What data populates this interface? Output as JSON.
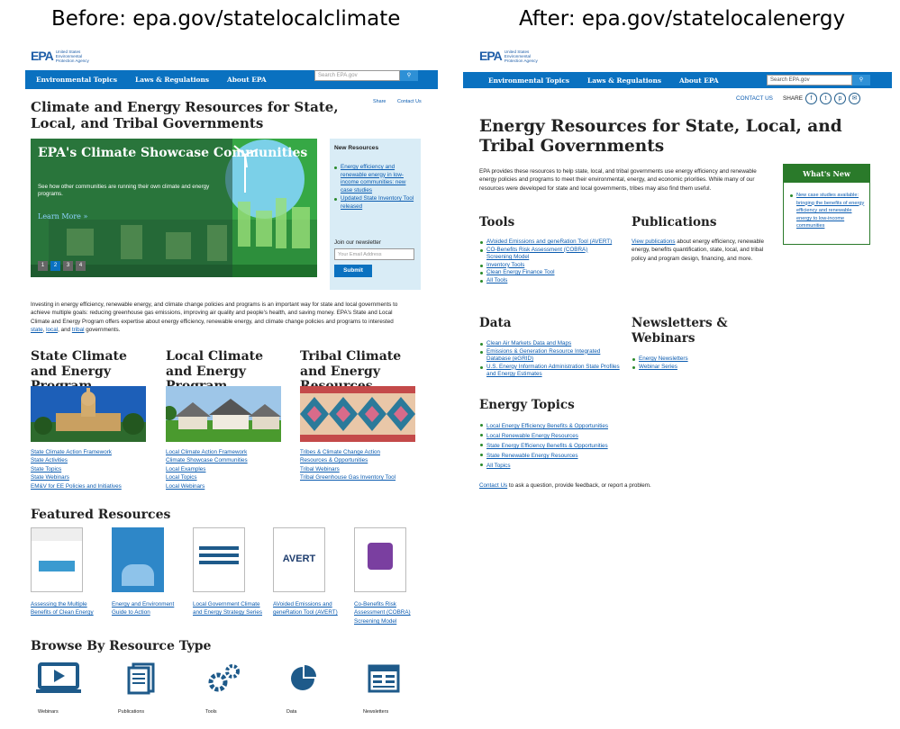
{
  "captions": {
    "before": "Before: epa.gov/statelocalclimate",
    "after": "After: epa.gov/statelocalenergy"
  },
  "header": {
    "logo_mark": "EPA",
    "agency": "United States Environmental Protection Agency",
    "search_placeholder": "Search EPA.gov",
    "search_icon": "magnifier-icon"
  },
  "before": {
    "nav": [
      "Environmental Topics",
      "Laws & Regulations",
      "About EPA"
    ],
    "share": "Share",
    "contact": "Contact Us",
    "title": "Climate and Energy Resources for State, Local, and Tribal Governments",
    "slide": {
      "title": "EPA's Climate Showcase Communities",
      "sub": "See how other communities are running their own climate and energy programs.",
      "more": "Learn More »",
      "dots": [
        "1",
        "2",
        "3",
        "4"
      ]
    },
    "new_resources": {
      "title": "New Resources",
      "items": [
        "Energy efficiency and renewable energy in low-income communities: new case studies",
        "Updated State Inventory Tool released"
      ]
    },
    "newsletter": {
      "label": "Join our newsletter",
      "placeholder": "Your Email Address",
      "button": "Submit"
    },
    "intro_a": "Investing in energy efficiency, renewable energy, and climate change policies and programs is an important way for state and local governments to achieve multiple goals: reducing greenhouse gas emissions, improving air quality and people's health, and saving money. EPA's State and Local Climate and Energy Program offers expertise about energy efficiency, renewable energy, and climate change policies and programs to interested ",
    "intro_links": [
      "state",
      "local",
      "tribal"
    ],
    "intro_sep": ", ",
    "intro_and": ", and ",
    "intro_end": " governments.",
    "programs": [
      {
        "title": "State Climate and Energy Program",
        "links": [
          "State Climate Action Framework",
          "State Activities",
          "State Topics",
          "State Webinars",
          "EM&V for EE Policies and Initiatives"
        ]
      },
      {
        "title": "Local Climate and Energy Program",
        "links": [
          "Local Climate Action Framework",
          "Climate Showcase Communities",
          "Local Examples",
          "Local Topics",
          "Local Webinars"
        ]
      },
      {
        "title": "Tribal Climate and Energy Resources",
        "links": [
          "Tribes & Climate Change Action",
          "Resources & Opportunities",
          "Tribal Webinars",
          "Tribal Greenhouse Gas Inventory Tool"
        ]
      }
    ],
    "featured_title": "Featured Resources",
    "featured": [
      "Assessing the Multiple Benefits of Clean Energy",
      "Energy and Environment Guide to Action",
      "Local Government Climate and Energy Strategy Series",
      "AVoided Emissions and geneRation Tool (AVERT)",
      "Co-Benefits Risk Assessment (COBRA) Screening Model"
    ],
    "browse_title": "Browse By Resource Type",
    "browse": [
      "Webinars",
      "Publications",
      "Tools",
      "Data",
      "Newsletters"
    ]
  },
  "after": {
    "nav": [
      "Environmental Topics",
      "Laws & Regulations",
      "About EPA"
    ],
    "contact": "CONTACT US",
    "share": "SHARE",
    "title": "Energy Resources for State, Local, and Tribal Governments",
    "intro": "EPA provides these resources to help state, local, and tribal governments use energy efficiency and renewable energy policies and programs to meet their environmental, energy, and economic priorities. While many of our resources were developed for state and local governments, tribes may also find them useful.",
    "whats_new": {
      "title": "What's New",
      "items": [
        "New case studies available: bringing the benefits of energy efficiency and renewable energy to low-income communities"
      ]
    },
    "tools": {
      "title": "Tools",
      "items": [
        "AVoided Emissions and geneRation Tool (AVERT)",
        "CO-Benefits Risk Assessment (COBRA) Screening Model",
        "Inventory Tools",
        "Clean Energy Finance Tool",
        "All Tools"
      ]
    },
    "publications": {
      "title": "Publications",
      "link": "View publications",
      "text": " about energy efficiency, renewable energy, benefits quantification, state, local, and tribal policy and program design, financing, and more."
    },
    "data": {
      "title": "Data",
      "items": [
        "Clean Air Markets Data and Maps",
        "Emissions & Generation Resource Integrated Database (eGRID)",
        "U.S. Energy Information Administration State Profiles and Energy Estimates"
      ]
    },
    "newsletters": {
      "title": "Newsletters & Webinars",
      "items": [
        "Energy Newsletters",
        "Webinar Series"
      ]
    },
    "topics": {
      "title": "Energy Topics",
      "items": [
        "Local Energy Efficiency Benefits & Opportunities",
        "Local Renewable Energy Resources",
        "State Energy Efficiency Benefits & Opportunities",
        "State Renewable Energy Resources",
        "All Topics"
      ]
    },
    "contact_link": "Contact Us",
    "contact_text": " to ask a question, provide feedback, or report a problem."
  },
  "colors": {
    "nav": "#0a71c0",
    "green": "#2a7a2a",
    "link": "#0a5bb0"
  }
}
